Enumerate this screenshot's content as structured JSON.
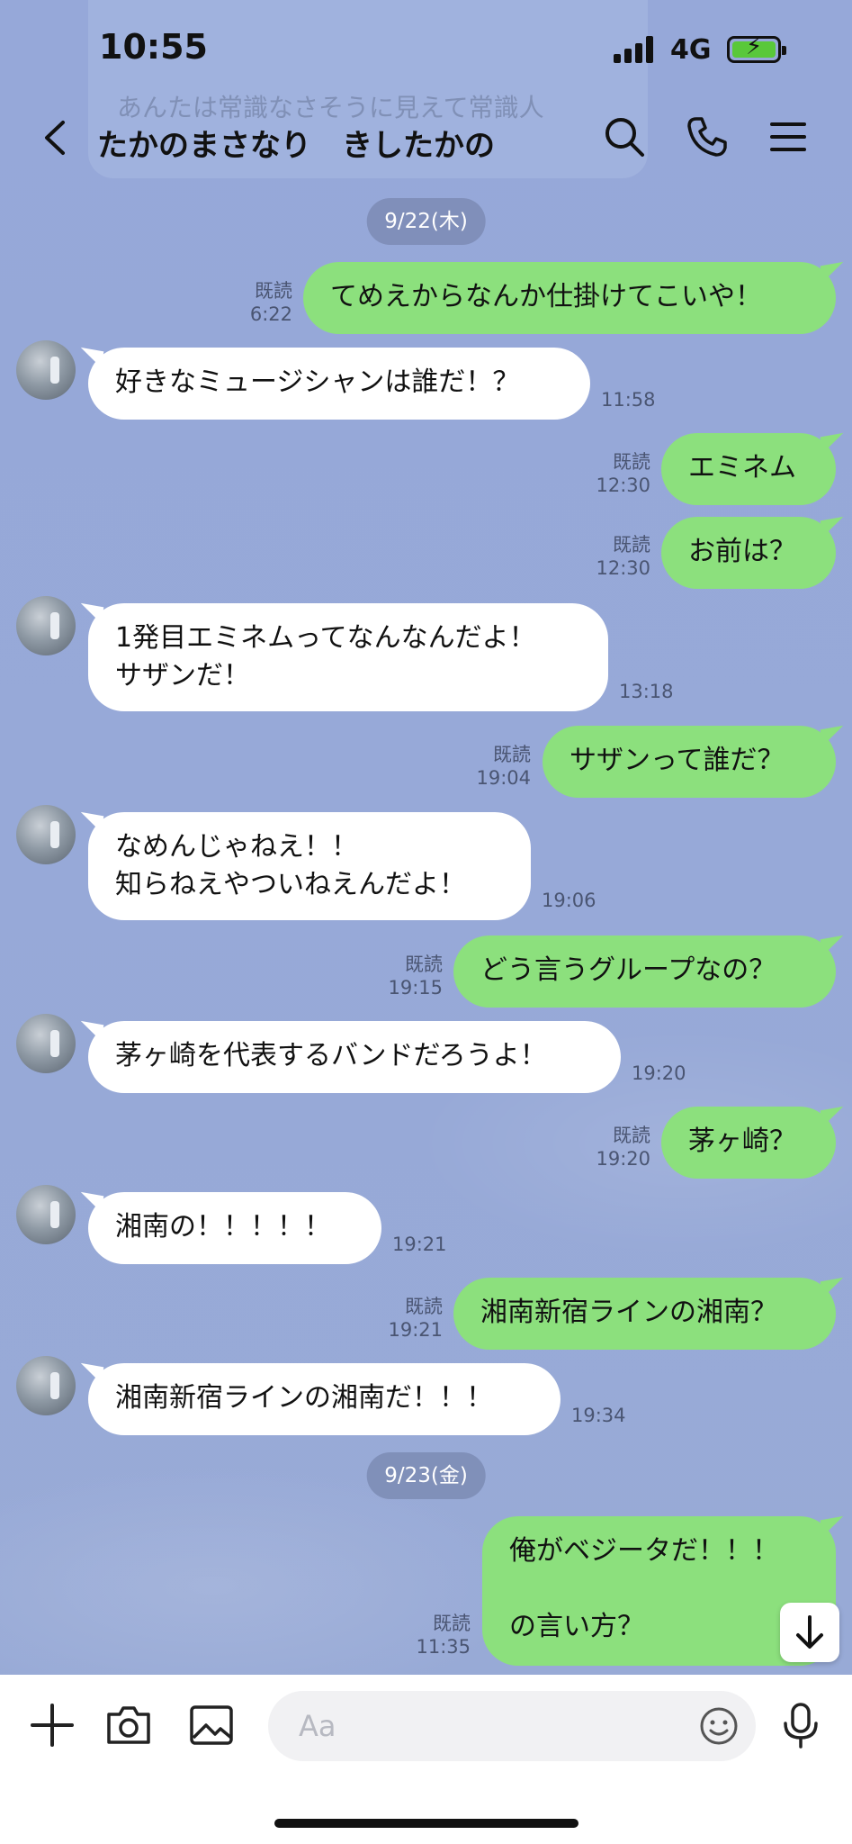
{
  "status_bar": {
    "time": "10:55",
    "network": "4G"
  },
  "ghost_popup": {
    "text": "あんたは常識なさそうに見えて常識人"
  },
  "header": {
    "title": "たかのまさなり　きしたかの"
  },
  "dates": [
    "9/22(木)",
    "9/23(金)"
  ],
  "messages": [
    {
      "dir": "out",
      "text": "てめえからなんか仕掛けてこいや！",
      "read": "既読",
      "time": "6:22"
    },
    {
      "dir": "in",
      "text": "好きなミュージシャンは誰だ！？",
      "time": "11:58"
    },
    {
      "dir": "out",
      "text": "エミネム",
      "read": "既読",
      "time": "12:30"
    },
    {
      "dir": "out",
      "text": "お前は？",
      "read": "既読",
      "time": "12:30"
    },
    {
      "dir": "in",
      "text": "1発目エミネムってなんなんだよ！\nサザンだ！",
      "time": "13:18"
    },
    {
      "dir": "out",
      "text": "サザンって誰だ？",
      "read": "既読",
      "time": "19:04"
    },
    {
      "dir": "in",
      "text": "なめんじゃねえ！！\n知らねえやついねえんだよ！",
      "time": "19:06"
    },
    {
      "dir": "out",
      "text": "どう言うグループなの？",
      "read": "既読",
      "time": "19:15"
    },
    {
      "dir": "in",
      "text": "茅ヶ崎を代表するバンドだろうよ！",
      "time": "19:20"
    },
    {
      "dir": "out",
      "text": "茅ヶ崎？",
      "read": "既読",
      "time": "19:20"
    },
    {
      "dir": "in",
      "text": "湘南の！！！！！",
      "time": "19:21"
    },
    {
      "dir": "out",
      "text": "湘南新宿ラインの湘南？",
      "read": "既読",
      "time": "19:21"
    },
    {
      "dir": "in",
      "text": "湘南新宿ラインの湘南だ！！！",
      "time": "19:34"
    },
    {
      "dir": "out",
      "text": "俺がベジータだ！！！\n\nの言い方？",
      "read": "既読",
      "time": "11:35"
    }
  ],
  "composer": {
    "placeholder": "Aa"
  },
  "icons": {
    "back": "chevron-left-icon",
    "search": "search-icon",
    "call": "phone-icon",
    "menu": "menu-icon",
    "plus": "plus-icon",
    "camera": "camera-icon",
    "image": "image-icon",
    "emoji": "emoji-icon",
    "mic": "mic-icon",
    "scroll": "arrow-down-icon"
  },
  "colors": {
    "background": "#97a9d8",
    "outgoing": "#8ce07d",
    "incoming": "#ffffff"
  }
}
